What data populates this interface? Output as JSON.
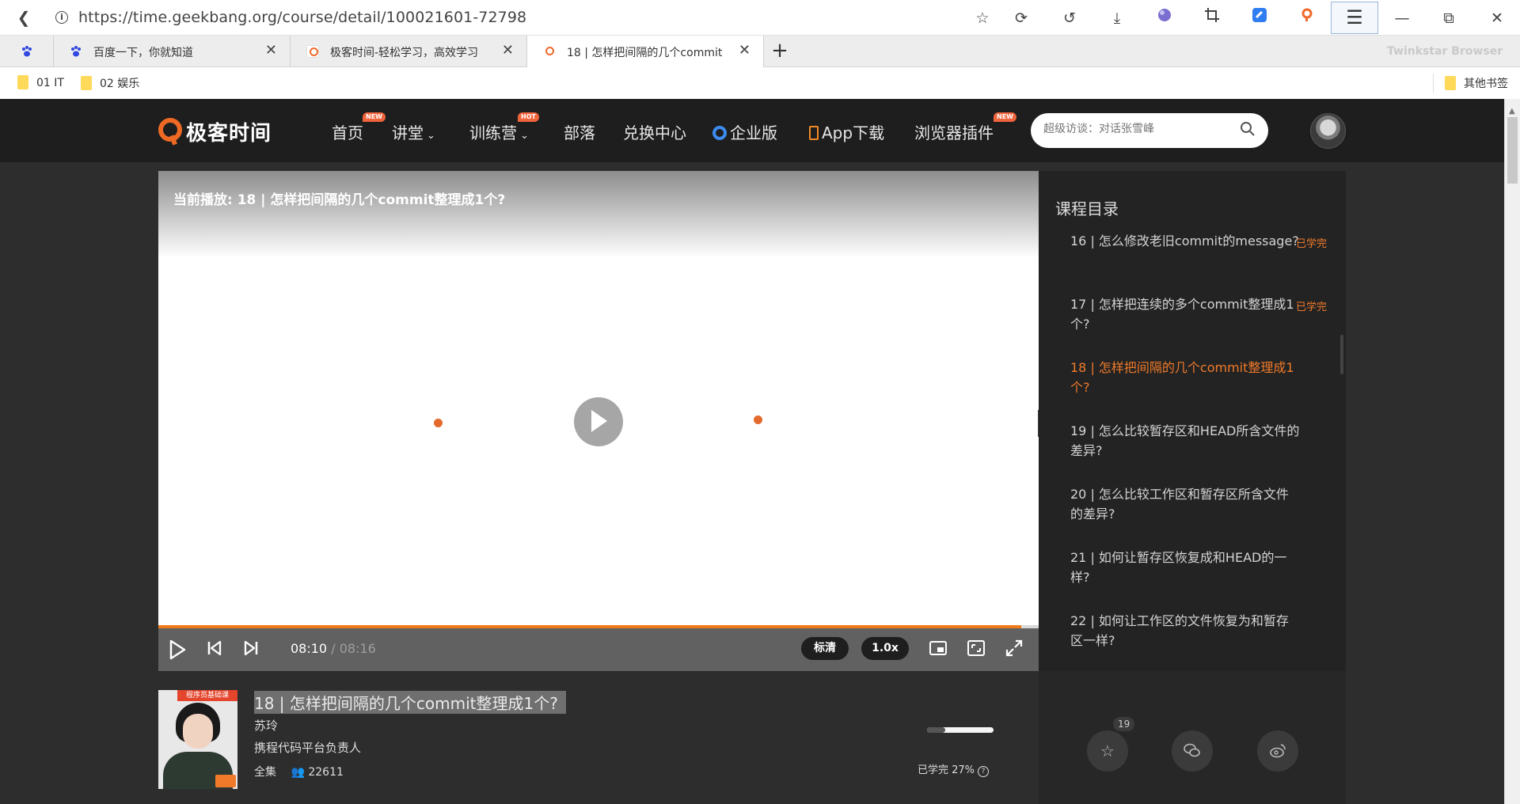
{
  "browser": {
    "url": "https://time.geekbang.org/course/detail/100021601-72798",
    "brand": "Twinkstar Browser",
    "tabs": [
      {
        "title": ""
      },
      {
        "title": "百度一下，你就知道"
      },
      {
        "title": "极客时间-轻松学习，高效学习"
      },
      {
        "title": "18 | 怎样把间隔的几个commit"
      }
    ],
    "bookmarks": [
      "01 IT",
      "02 娱乐"
    ],
    "other_bookmarks": "其他书签"
  },
  "nav": {
    "logo": "极客时间",
    "items": [
      "首页",
      "讲堂",
      "训练营",
      "部落",
      "兑换中心",
      "企业版",
      "App下载",
      "浏览器插件"
    ],
    "badges": {
      "home": "NEW",
      "camp": "HOT",
      "plugin": "NEW"
    },
    "search_placeholder": "超级访谈：对话张雪峰"
  },
  "player": {
    "now_playing": "当前播放: 18 | 怎样把间隔的几个commit整理成1个?",
    "current_time": "08:10",
    "separator": "/",
    "total_time": "08:16",
    "progress": 0.98,
    "quality": "标清",
    "speed": "1.0x"
  },
  "playlist": {
    "heading": "课程目录",
    "items": [
      {
        "title": "16 | 怎么修改老旧commit的message?",
        "status": "已学完"
      },
      {
        "title": "17 | 怎样把连续的多个commit整理成1个?",
        "status": "已学完"
      },
      {
        "title": "18 | 怎样把间隔的几个commit整理成1个?",
        "status": ""
      },
      {
        "title": "19 | 怎么比较暂存区和HEAD所含文件的差异?",
        "status": ""
      },
      {
        "title": "20 | 怎么比较工作区和暂存区所含文件的差异?",
        "status": ""
      },
      {
        "title": "21 | 如何让暂存区恢复成和HEAD的一样?",
        "status": ""
      },
      {
        "title": "22 | 如何让工作区的文件恢复为和暂存区一样?",
        "status": ""
      }
    ]
  },
  "course": {
    "thumb_tag": "程序员基础课",
    "lesson_title": "18 | 怎样把间隔的几个commit整理成1个?",
    "author": "苏玲",
    "role": "携程代码平台负责人",
    "collection": "全集",
    "learners": "22611",
    "learned_pct": "已学完 27%",
    "learned_fraction": 0.27
  },
  "actions": {
    "favorite_count": "19"
  }
}
